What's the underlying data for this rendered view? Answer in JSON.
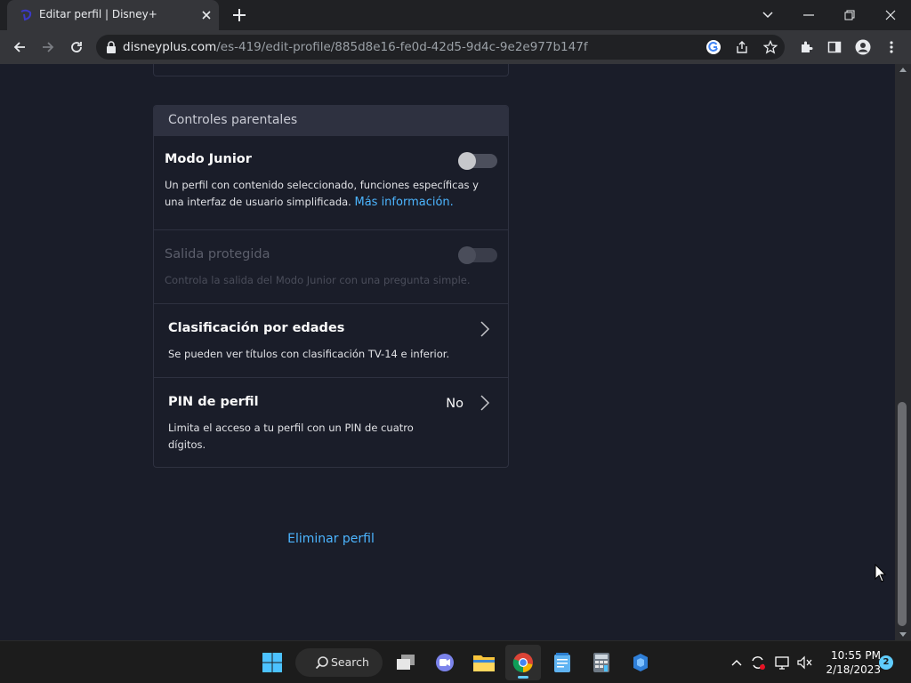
{
  "browser": {
    "tab_title": "Editar perfil | Disney+",
    "url_host": "disneyplus.com",
    "url_path": "/es-419/edit-profile/885d8e16-fe0d-42d5-9d4c-9e2e977b147f"
  },
  "parental_controls": {
    "section_title": "Controles parentales",
    "junior_mode": {
      "title": "Modo Junior",
      "description": "Un perfil con contenido seleccionado, funciones específicas y una interfaz de usuario simplificada.",
      "link_text": "Más información.",
      "enabled": false
    },
    "protected_exit": {
      "title": "Salida protegida",
      "description": "Controla la salida del Modo Junior con una pregunta simple.",
      "enabled": false
    },
    "age_rating": {
      "title": "Clasificación por edades",
      "description": "Se pueden ver títulos con clasificación TV-14 e inferior."
    },
    "profile_pin": {
      "title": "PIN de perfil",
      "value": "No",
      "description_line1": "Limita el acceso a tu perfil con un PIN de cuatro",
      "description_line2": "dígitos."
    }
  },
  "delete_profile_label": "Eliminar perfil",
  "taskbar": {
    "search_label": "Search",
    "time": "10:55 PM",
    "date": "2/18/2023",
    "notification_count": "2"
  },
  "colors": {
    "page_background": "#1a1d29",
    "link": "#4cb5ff",
    "panel_border": "#2e3140"
  }
}
